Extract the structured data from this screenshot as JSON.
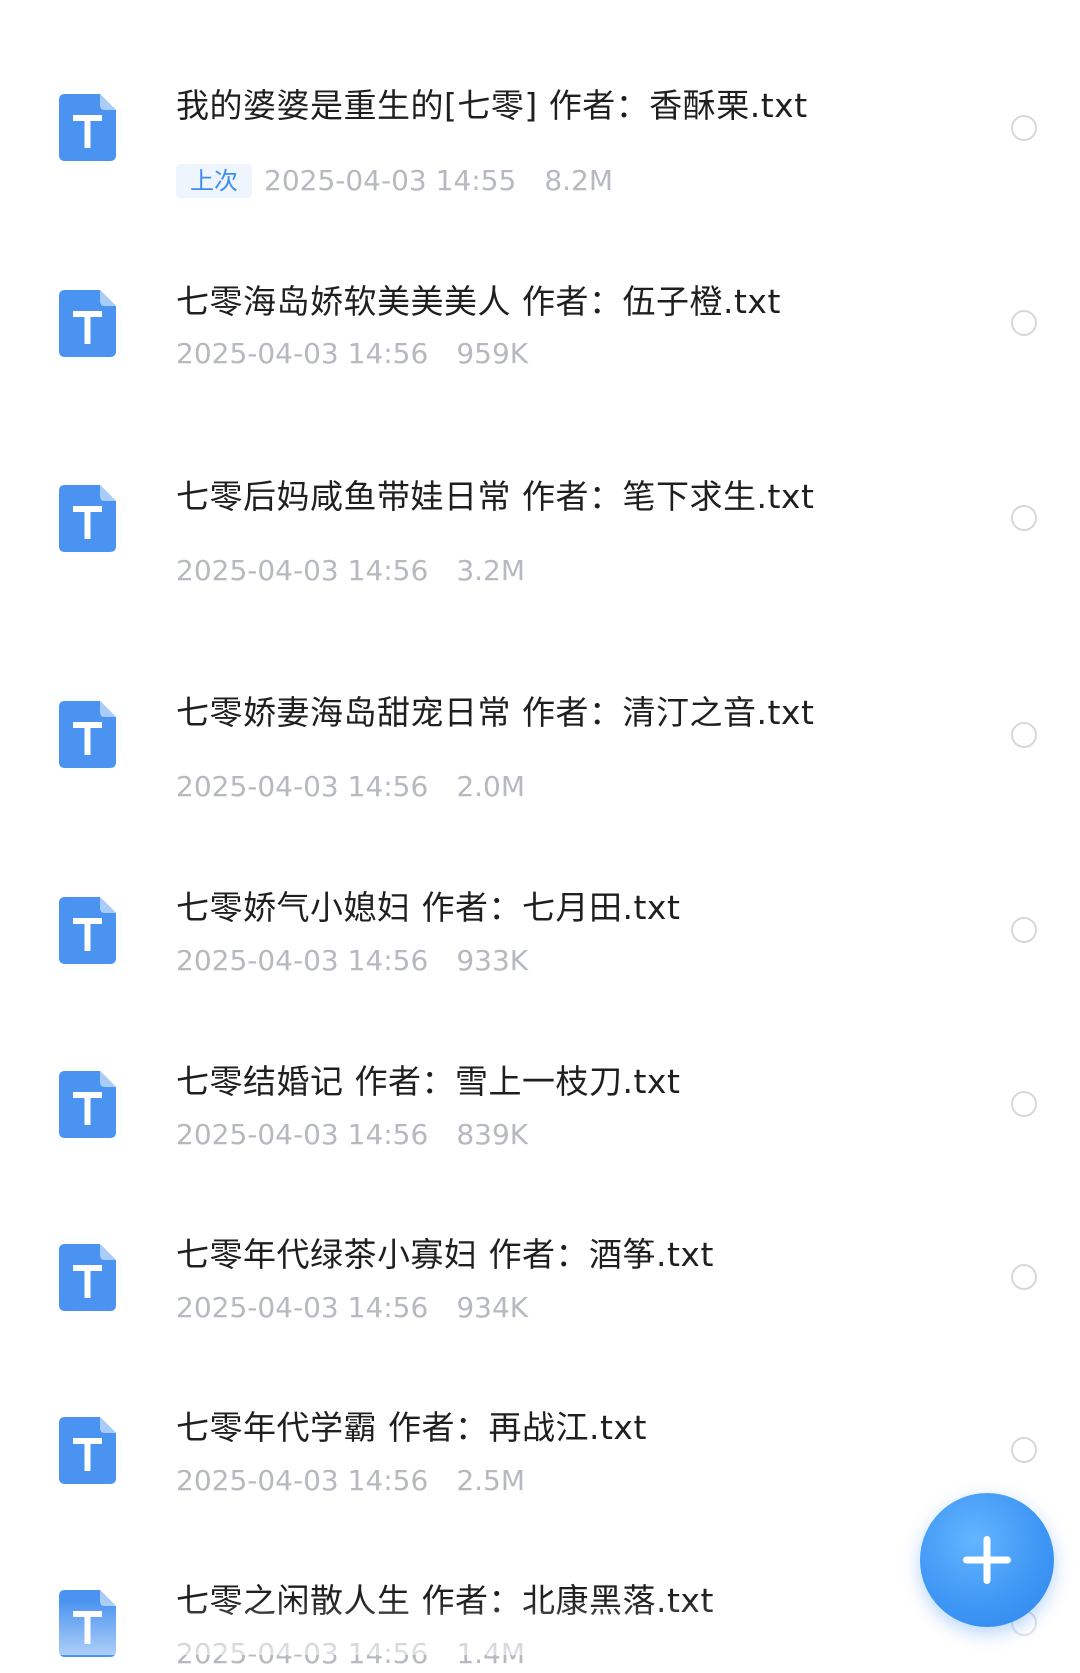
{
  "files": [
    {
      "name": "我的婆婆是重生的[七零] 作者：香酥栗.txt",
      "badge": "上次",
      "date": "2025-04-03 14:55",
      "size": "8.2M"
    },
    {
      "name": "七零海岛娇软美美美人 作者：伍子橙.txt",
      "date": "2025-04-03 14:56",
      "size": "959K"
    },
    {
      "name": "七零后妈咸鱼带娃日常 作者：笔下求生.txt",
      "date": "2025-04-03 14:56",
      "size": "3.2M"
    },
    {
      "name": "七零娇妻海岛甜宠日常 作者：清汀之音.txt",
      "date": "2025-04-03 14:56",
      "size": "2.0M"
    },
    {
      "name": "七零娇气小媳妇 作者：七月田.txt",
      "date": "2025-04-03 14:56",
      "size": "933K"
    },
    {
      "name": "七零结婚记 作者：雪上一枝刀.txt",
      "date": "2025-04-03 14:56",
      "size": "839K"
    },
    {
      "name": "七零年代绿茶小寡妇 作者：酒筝.txt",
      "date": "2025-04-03 14:56",
      "size": "934K"
    },
    {
      "name": "七零年代学霸 作者：再战江.txt",
      "date": "2025-04-03 14:56",
      "size": "2.5M"
    },
    {
      "name": "七零之闲散人生 作者：北康黑落.txt",
      "date": "2025-04-03 14:56",
      "size": "1.4M"
    }
  ],
  "icon": {
    "letter": "T",
    "color": "#4a93f0",
    "fold_color": "#a9cdf8"
  },
  "fab": {
    "icon": "plus-icon",
    "color": "#3d95f4"
  }
}
